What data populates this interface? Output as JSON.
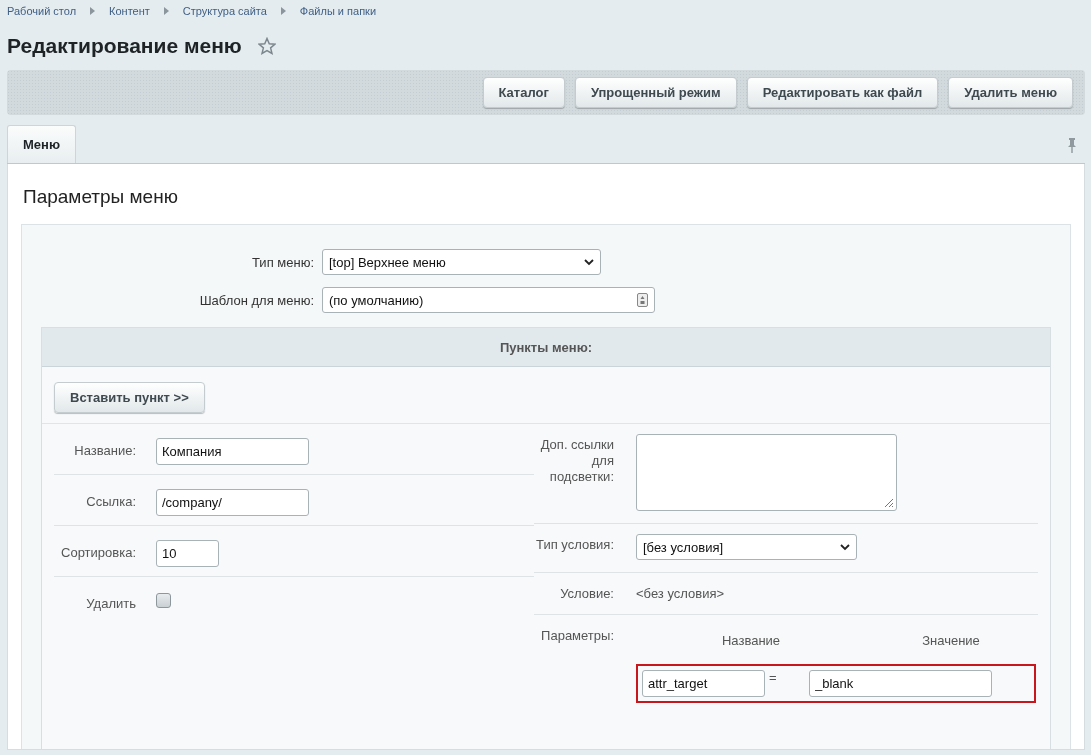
{
  "breadcrumbs": [
    "Рабочий стол",
    "Контент",
    "Структура сайта",
    "Файлы и папки"
  ],
  "title": "Редактирование меню",
  "favorite": false,
  "toolbar_buttons": [
    "Каталог",
    "Упрощенный режим",
    "Редактировать как файл",
    "Удалить меню"
  ],
  "tabs": [
    {
      "label": "Меню",
      "selected": true
    }
  ],
  "pinned": false,
  "section_title": "Параметры меню",
  "menu_type": {
    "label": "Тип меню:",
    "value": "[top] Верхнее меню"
  },
  "menu_template": {
    "label": "Шаблон для меню:",
    "value": "(по умолчанию)"
  },
  "items_panel": {
    "title": "Пункты меню:",
    "insert_button": "Вставить пункт >>",
    "left_fields": [
      {
        "kind": "text",
        "label": "Название:",
        "value": "Компания"
      },
      {
        "kind": "text",
        "label": "Ссылка:",
        "value": "/company/"
      },
      {
        "kind": "short",
        "label": "Сортировка:",
        "value": "10"
      },
      {
        "kind": "checkbox",
        "label": "Удалить",
        "checked": false
      }
    ],
    "right_fields": [
      {
        "kind": "textarea",
        "label": "Доп. ссылки для подсветки:"
      },
      {
        "kind": "select",
        "label": "Тип условия:",
        "value": "[без условия]"
      },
      {
        "kind": "static",
        "label": "Условие:",
        "value": "<без условия>"
      },
      {
        "kind": "params",
        "label": "Параметры:",
        "columns": [
          "Название",
          "Значение"
        ],
        "rows": [
          {
            "name": "attr_target",
            "separator": "=",
            "value": "_blank",
            "highlighted": true
          }
        ]
      }
    ]
  }
}
